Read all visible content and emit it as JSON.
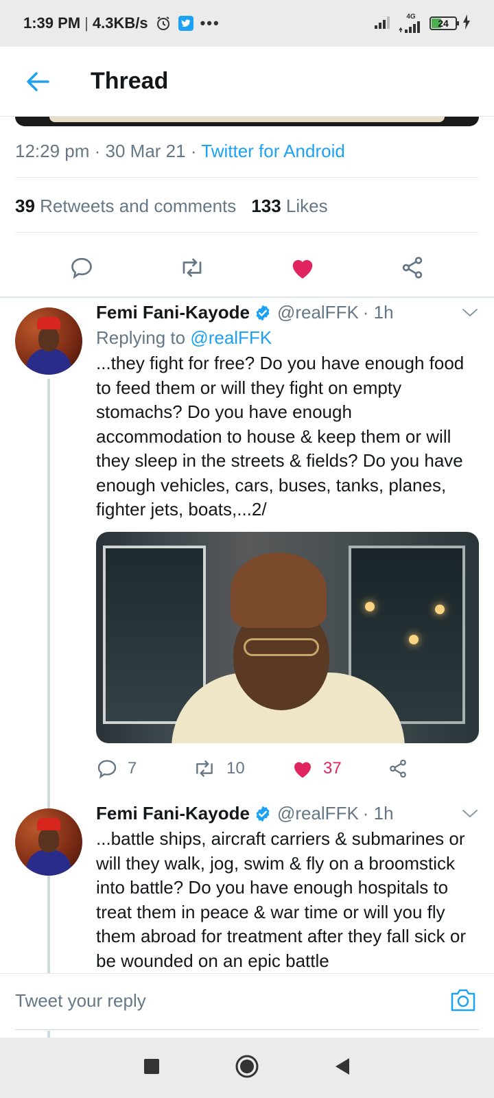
{
  "status_bar": {
    "time": "1:39 PM",
    "speed": "4.3KB/s",
    "network": "4G",
    "battery": "24"
  },
  "header": {
    "title": "Thread"
  },
  "main_tweet": {
    "time": "12:29 pm",
    "date": "30 Mar 21",
    "source": "Twitter for Android",
    "retweets_count": "39",
    "retweets_label": "Retweets and comments",
    "likes_count": "133",
    "likes_label": "Likes"
  },
  "tweets": [
    {
      "name": "Femi Fani-Kayode",
      "handle": "@realFFK",
      "time": "· 1h",
      "replying_label": "Replying to",
      "replying_to": "@realFFK",
      "text": "...they fight for free? Do you have enough food to feed them or will they fight on empty stomachs? Do you have enough accommodation to house & keep them or will they sleep in the streets & fields? Do you have enough vehicles, cars, buses, tanks, planes, fighter jets, boats,...2/",
      "replies": "7",
      "retweets": "10",
      "likes": "37"
    },
    {
      "name": "Femi Fani-Kayode",
      "handle": "@realFFK",
      "time": "· 1h",
      "text": "...battle ships, aircraft carriers & submarines or will they walk, jog, swim & fly on a broomstick into battle? Do you have enough hospitals to treat them in peace & war time or will you fly them abroad for treatment after they fall sick or be wounded on an epic battle"
    }
  ],
  "reply_bar": {
    "placeholder": "Tweet your reply"
  },
  "colors": {
    "accent": "#1da1f2",
    "like": "#e0245e",
    "secondary_text": "#657786"
  }
}
